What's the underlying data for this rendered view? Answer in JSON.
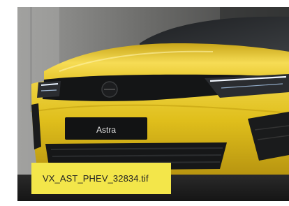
{
  "image": {
    "subject": "yellow-car-front",
    "grille_badge_text": "Astra"
  },
  "caption": {
    "filename": "VX_AST_PHEV_32834.tif"
  },
  "colors": {
    "car_body": "#e2c21e",
    "caption_bg": "#f3e64a"
  }
}
